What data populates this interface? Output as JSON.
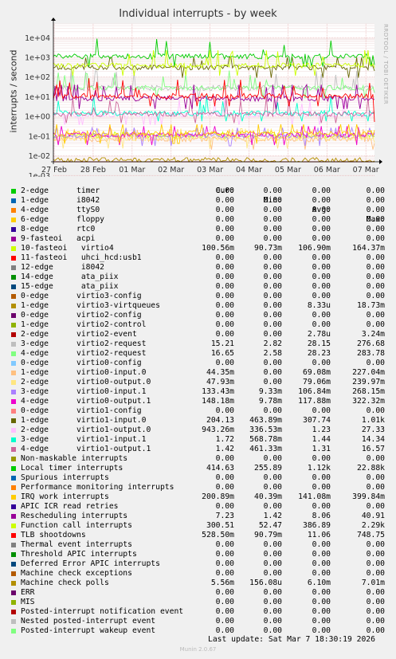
{
  "chart_data": {
    "type": "line",
    "title": "Individual interrupts - by week",
    "ylabel": "interrupts / second",
    "yscale": "log",
    "ylim": [
      0.005,
      50000
    ],
    "yticks": [
      "1e+04",
      "1e+03",
      "1e+02",
      "1e+01",
      "1e+00",
      "1e-01",
      "1e-02",
      "1e-03"
    ],
    "xticks": [
      "27 Feb",
      "28 Feb",
      "01 Mar",
      "02 Mar",
      "03 Mar",
      "04 Mar",
      "05 Mar",
      "06 Mar",
      "07 Mar"
    ],
    "grid": true,
    "watermark": "RRDTOOL / TOBI OETIKER",
    "columns": [
      "Cur:",
      "Min:",
      "Avg:",
      "Max:"
    ],
    "series": [
      {
        "name": "2-edge      timer",
        "color": "#00cc00",
        "cur": "0.00",
        "min": "0.00",
        "avg": "0.00",
        "max": "0.00"
      },
      {
        "name": "1-edge      i8042",
        "color": "#0066b3",
        "cur": "0.00",
        "min": "0.00",
        "avg": "0.00",
        "max": "0.00"
      },
      {
        "name": "4-edge      ttyS0",
        "color": "#ff8000",
        "cur": "0.00",
        "min": "0.00",
        "avg": "0.00",
        "max": "0.00"
      },
      {
        "name": "6-edge      floppy",
        "color": "#ffcc00",
        "cur": "0.00",
        "min": "0.00",
        "avg": "0.00",
        "max": "0.00"
      },
      {
        "name": "8-edge      rtc0",
        "color": "#330099",
        "cur": "0.00",
        "min": "0.00",
        "avg": "0.00",
        "max": "0.00"
      },
      {
        "name": "9-fasteoi   acpi",
        "color": "#990099",
        "cur": "0.00",
        "min": "0.00",
        "avg": "0.00",
        "max": "0.00"
      },
      {
        "name": "10-fasteoi   virtio4",
        "color": "#ccff00",
        "cur": "100.56m",
        "min": "90.73m",
        "avg": "106.90m",
        "max": "164.37m"
      },
      {
        "name": "11-fasteoi   uhci_hcd:usb1",
        "color": "#ff0000",
        "cur": "0.00",
        "min": "0.00",
        "avg": "0.00",
        "max": "0.00"
      },
      {
        "name": "12-edge      i8042",
        "color": "#808080",
        "cur": "0.00",
        "min": "0.00",
        "avg": "0.00",
        "max": "0.00"
      },
      {
        "name": "14-edge      ata_piix",
        "color": "#008f00",
        "cur": "0.00",
        "min": "0.00",
        "avg": "0.00",
        "max": "0.00"
      },
      {
        "name": "15-edge      ata_piix",
        "color": "#00487d",
        "cur": "0.00",
        "min": "0.00",
        "avg": "0.00",
        "max": "0.00"
      },
      {
        "name": "0-edge      virtio3-config",
        "color": "#b35a00",
        "cur": "0.00",
        "min": "0.00",
        "avg": "0.00",
        "max": "0.00"
      },
      {
        "name": "1-edge      virtio3-virtqueues",
        "color": "#b38f00",
        "cur": "0.00",
        "min": "0.00",
        "avg": "8.33u",
        "max": "18.73m"
      },
      {
        "name": "0-edge      virtio2-config",
        "color": "#6b006b",
        "cur": "0.00",
        "min": "0.00",
        "avg": "0.00",
        "max": "0.00"
      },
      {
        "name": "1-edge      virtio2-control",
        "color": "#8fb300",
        "cur": "0.00",
        "min": "0.00",
        "avg": "0.00",
        "max": "0.00"
      },
      {
        "name": "2-edge      virtio2-event",
        "color": "#b30000",
        "cur": "0.00",
        "min": "0.00",
        "avg": "2.78u",
        "max": "3.24m"
      },
      {
        "name": "3-edge      virtio2-request",
        "color": "#bebebe",
        "cur": "15.21",
        "min": "2.82",
        "avg": "28.15",
        "max": "276.68"
      },
      {
        "name": "4-edge      virtio2-request",
        "color": "#80ff80",
        "cur": "16.65",
        "min": "2.58",
        "avg": "28.23",
        "max": "283.78"
      },
      {
        "name": "0-edge      virtio0-config",
        "color": "#80c9ff",
        "cur": "0.00",
        "min": "0.00",
        "avg": "0.00",
        "max": "0.00"
      },
      {
        "name": "1-edge      virtio0-input.0",
        "color": "#ffc080",
        "cur": "44.35m",
        "min": "0.00",
        "avg": "69.08m",
        "max": "227.04m"
      },
      {
        "name": "2-edge      virtio0-output.0",
        "color": "#ffe680",
        "cur": "47.93m",
        "min": "0.00",
        "avg": "79.06m",
        "max": "239.97m"
      },
      {
        "name": "3-edge      virtio0-input.1",
        "color": "#aa80ff",
        "cur": "133.43m",
        "min": "9.33m",
        "avg": "106.84m",
        "max": "268.15m"
      },
      {
        "name": "4-edge      virtio0-output.1",
        "color": "#ee00cc",
        "cur": "148.18m",
        "min": "9.78m",
        "avg": "117.88m",
        "max": "322.32m"
      },
      {
        "name": "0-edge      virtio1-config",
        "color": "#ff8080",
        "cur": "0.00",
        "min": "0.00",
        "avg": "0.00",
        "max": "0.00"
      },
      {
        "name": "1-edge      virtio1-input.0",
        "color": "#666600",
        "cur": "204.13",
        "min": "463.89m",
        "avg": "307.74",
        "max": "1.01k"
      },
      {
        "name": "2-edge      virtio1-output.0",
        "color": "#ffbfff",
        "cur": "943.26m",
        "min": "336.53m",
        "avg": "1.23",
        "max": "27.33"
      },
      {
        "name": "3-edge      virtio1-input.1",
        "color": "#00ffcc",
        "cur": "1.72",
        "min": "568.78m",
        "avg": "1.44",
        "max": "14.34"
      },
      {
        "name": "4-edge      virtio1-output.1",
        "color": "#cc6699",
        "cur": "1.42",
        "min": "461.33m",
        "avg": "1.31",
        "max": "16.57"
      },
      {
        "name": "Non-maskable interrupts",
        "color": "#999900",
        "cur": "0.00",
        "min": "0.00",
        "avg": "0.00",
        "max": "0.00"
      },
      {
        "name": "Local timer interrupts",
        "color": "#00cc00",
        "cur": "414.63",
        "min": "255.89",
        "avg": "1.12k",
        "max": "22.88k"
      },
      {
        "name": "Spurious interrupts",
        "color": "#0066b3",
        "cur": "0.00",
        "min": "0.00",
        "avg": "0.00",
        "max": "0.00"
      },
      {
        "name": "Performance monitoring interrupts",
        "color": "#ff8000",
        "cur": "0.00",
        "min": "0.00",
        "avg": "0.00",
        "max": "0.00"
      },
      {
        "name": "IRQ work interrupts",
        "color": "#ffcc00",
        "cur": "200.89m",
        "min": "40.39m",
        "avg": "141.08m",
        "max": "399.84m"
      },
      {
        "name": "APIC ICR read retries",
        "color": "#330099",
        "cur": "0.00",
        "min": "0.00",
        "avg": "0.00",
        "max": "0.00"
      },
      {
        "name": "Rescheduling interrupts",
        "color": "#990099",
        "cur": "7.23",
        "min": "1.42",
        "avg": "8.06",
        "max": "40.91"
      },
      {
        "name": "Function call interrupts",
        "color": "#ccff00",
        "cur": "300.51",
        "min": "52.47",
        "avg": "386.89",
        "max": "2.29k"
      },
      {
        "name": "TLB shootdowns",
        "color": "#ff0000",
        "cur": "528.50m",
        "min": "90.79m",
        "avg": "11.06",
        "max": "748.75"
      },
      {
        "name": "Thermal event interrupts",
        "color": "#808080",
        "cur": "0.00",
        "min": "0.00",
        "avg": "0.00",
        "max": "0.00"
      },
      {
        "name": "Threshold APIC interrupts",
        "color": "#008f00",
        "cur": "0.00",
        "min": "0.00",
        "avg": "0.00",
        "max": "0.00"
      },
      {
        "name": "Deferred Error APIC interrupts",
        "color": "#00487d",
        "cur": "0.00",
        "min": "0.00",
        "avg": "0.00",
        "max": "0.00"
      },
      {
        "name": "Machine check exceptions",
        "color": "#b35a00",
        "cur": "0.00",
        "min": "0.00",
        "avg": "0.00",
        "max": "0.00"
      },
      {
        "name": "Machine check polls",
        "color": "#b38f00",
        "cur": "5.56m",
        "min": "156.08u",
        "avg": "6.10m",
        "max": "7.01m"
      },
      {
        "name": "ERR",
        "color": "#6b006b",
        "cur": "0.00",
        "min": "0.00",
        "avg": "0.00",
        "max": "0.00"
      },
      {
        "name": "MIS",
        "color": "#8fb300",
        "cur": "0.00",
        "min": "0.00",
        "avg": "0.00",
        "max": "0.00"
      },
      {
        "name": "Posted-interrupt notification event",
        "color": "#b30000",
        "cur": "0.00",
        "min": "0.00",
        "avg": "0.00",
        "max": "0.00"
      },
      {
        "name": "Nested posted-interrupt event",
        "color": "#bebebe",
        "cur": "0.00",
        "min": "0.00",
        "avg": "0.00",
        "max": "0.00"
      },
      {
        "name": "Posted-interrupt wakeup event",
        "color": "#80ff80",
        "cur": "0.00",
        "min": "0.00",
        "avg": "0.00",
        "max": "0.00"
      }
    ]
  },
  "footer": {
    "last_update": "Last update: Sat Mar  7 18:30:19 2026",
    "version": "Munin 2.0.67"
  }
}
